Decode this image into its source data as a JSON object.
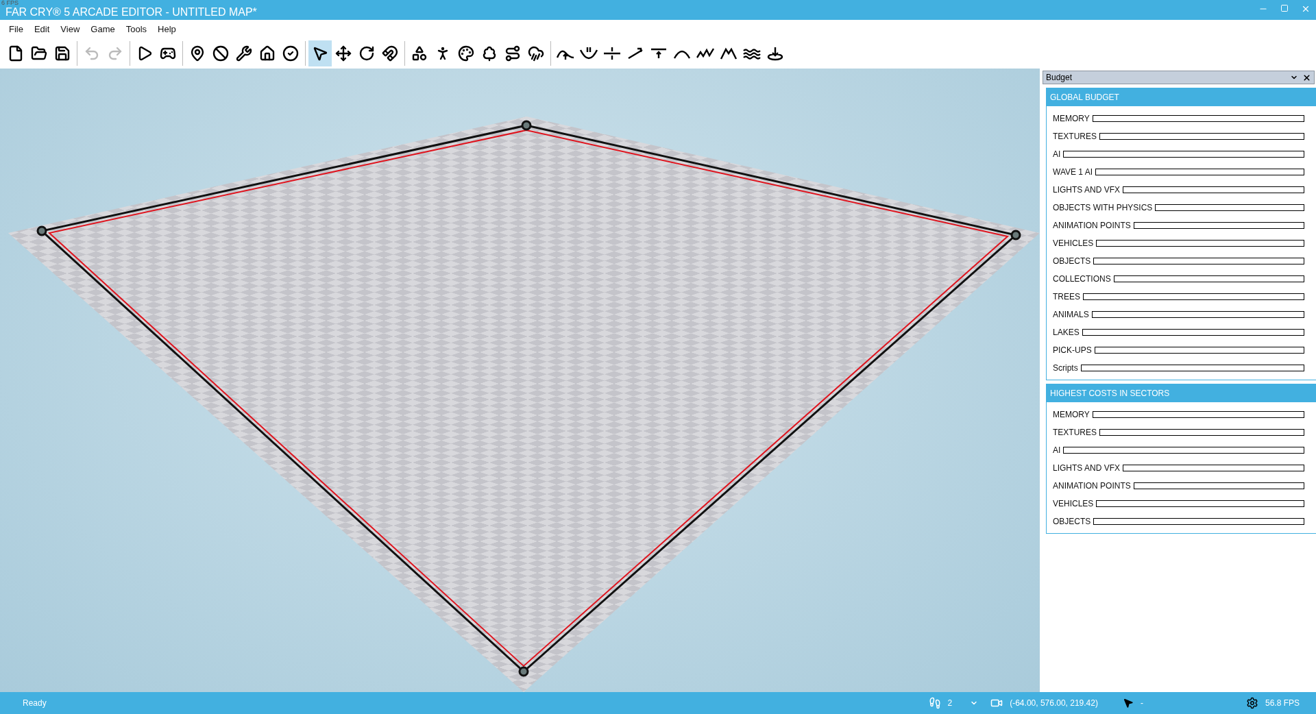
{
  "window": {
    "title": "FAR CRY® 5 ARCADE EDITOR - UNTITLED MAP*",
    "fps_overlay": "6 FPS"
  },
  "menu": [
    "File",
    "Edit",
    "View",
    "Game",
    "Tools",
    "Help"
  ],
  "toolbar": {
    "groups": [
      [
        {
          "selected": false,
          "disabled": false
        },
        {
          "selected": false,
          "disabled": false
        },
        {
          "selected": false,
          "disabled": false
        }
      ],
      [
        {
          "selected": false,
          "disabled": true
        },
        {
          "selected": false,
          "disabled": true
        }
      ],
      [
        {
          "selected": false,
          "disabled": false
        },
        {
          "selected": false,
          "disabled": false
        }
      ],
      [
        {
          "selected": false,
          "disabled": false
        },
        {
          "selected": false,
          "disabled": false
        },
        {
          "selected": false,
          "disabled": false
        },
        {
          "selected": false,
          "disabled": false
        },
        {
          "selected": false,
          "disabled": false
        }
      ],
      [
        {
          "selected": true,
          "disabled": false
        },
        {
          "selected": false,
          "disabled": false
        },
        {
          "selected": false,
          "disabled": false
        },
        {
          "selected": false,
          "disabled": false
        }
      ],
      [
        {
          "selected": false,
          "disabled": false
        },
        {
          "selected": false,
          "disabled": false
        },
        {
          "selected": false,
          "disabled": false
        },
        {
          "selected": false,
          "disabled": false
        },
        {
          "selected": false,
          "disabled": false
        },
        {
          "selected": false,
          "disabled": false
        }
      ],
      [
        {
          "selected": false,
          "disabled": false
        },
        {
          "selected": false,
          "disabled": false
        },
        {
          "selected": false,
          "disabled": false
        },
        {
          "selected": false,
          "disabled": false
        },
        {
          "selected": false,
          "disabled": false
        },
        {
          "selected": false,
          "disabled": false
        },
        {
          "selected": false,
          "disabled": false
        },
        {
          "selected": false,
          "disabled": false
        },
        {
          "selected": false,
          "disabled": false
        },
        {
          "selected": false,
          "disabled": false
        }
      ]
    ]
  },
  "budget_panel": {
    "title": "Budget",
    "sections": [
      {
        "title": "GLOBAL BUDGET",
        "meters": [
          {
            "name": "MEMORY",
            "level": 0
          },
          {
            "name": "TEXTURES",
            "level": 0
          },
          {
            "name": "AI",
            "level": 0
          },
          {
            "name": "WAVE 1 AI",
            "level": 0
          },
          {
            "name": "LIGHTS AND VFX",
            "level": 0
          },
          {
            "name": "OBJECTS WITH PHYSICS",
            "level": 0
          },
          {
            "name": "ANIMATION POINTS",
            "level": 0
          },
          {
            "name": "VEHICLES",
            "level": 0
          },
          {
            "name": "OBJECTS",
            "level": 0
          },
          {
            "name": "COLLECTIONS",
            "level": 0
          },
          {
            "name": "TREES",
            "level": 0
          },
          {
            "name": "ANIMALS",
            "level": 0
          },
          {
            "name": "LAKES",
            "level": 0
          },
          {
            "name": "PICK-UPS",
            "level": 0
          },
          {
            "name": "Scripts",
            "level": 0
          }
        ]
      },
      {
        "title": "HIGHEST COSTS IN SECTORS",
        "meters": [
          {
            "name": "MEMORY",
            "level": 0
          },
          {
            "name": "TEXTURES",
            "level": 0
          },
          {
            "name": "AI",
            "level": 0
          },
          {
            "name": "LIGHTS AND VFX",
            "level": 0
          },
          {
            "name": "ANIMATION POINTS",
            "level": 0
          },
          {
            "name": "VEHICLES",
            "level": 0
          },
          {
            "name": "OBJECTS",
            "level": 0
          }
        ]
      }
    ]
  },
  "status_bar": {
    "status": "Ready",
    "players": "2",
    "camera_position": "(-64.00, 576.00, 219.42)",
    "cursor_position": "-",
    "fps": "56.8 FPS"
  }
}
